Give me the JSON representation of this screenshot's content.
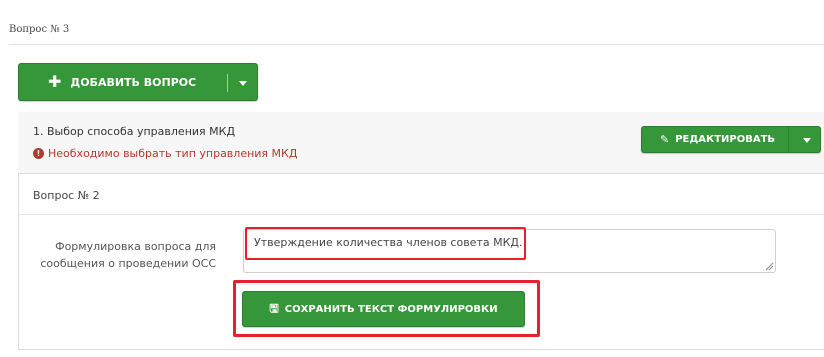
{
  "header": {
    "question_label": "Вопрос № 3"
  },
  "add_button": {
    "label": "ДОБАВИТЬ ВОПРОС",
    "icon": "plus-icon"
  },
  "question_item": {
    "title": "1. Выбор способа управления МКД",
    "warning": "Необходимо выбрать тип управления МКД",
    "warning_icon": "exclamation-circle-icon",
    "edit_label": "РЕДАКТИРОВАТЬ"
  },
  "question_two": {
    "label": "Вопрос № 2",
    "form_label": "Формулировка вопроса для сообщения о проведении ОСС",
    "textarea_value": "Утверждение количества членов совета МКД.",
    "save_label": "СОХРАНИТЬ ТЕКСТ ФОРМУЛИРОВКИ",
    "save_icon": "floppy-disk-icon"
  },
  "colors": {
    "button_green": "#35963a",
    "warning_red": "#b03a2e",
    "highlight_red": "#e8202a"
  }
}
